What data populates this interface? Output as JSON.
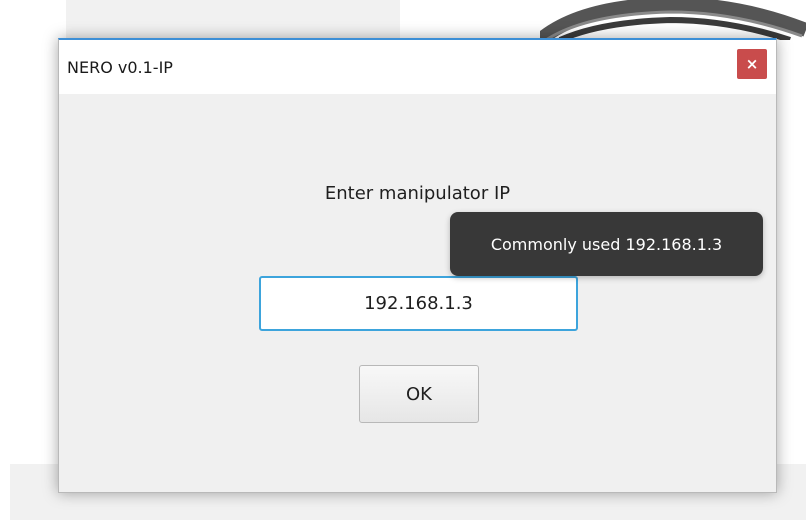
{
  "window": {
    "title": "NERO v0.1-IP",
    "close_label": "×"
  },
  "dialog": {
    "prompt": "Enter manipulator IP",
    "ip_value": "192.168.1.3",
    "ok_label": "OK"
  },
  "tooltip": {
    "text": "Commonly used 192.168.1.3"
  },
  "colors": {
    "title_accent": "#3d8fd6",
    "close_button": "#c94c4c",
    "input_focus_border": "#3da4dc",
    "tooltip_bg": "#282828"
  }
}
